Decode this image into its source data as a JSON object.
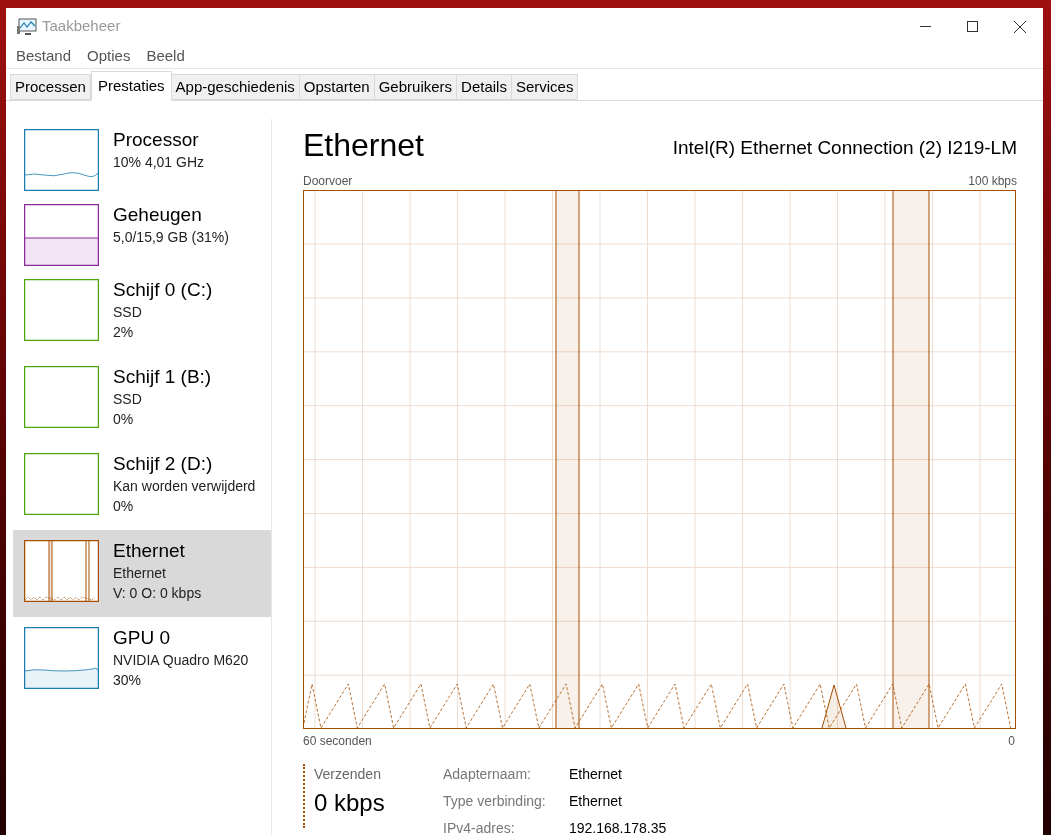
{
  "window": {
    "title": "Taakbeheer"
  },
  "menu": [
    "Bestand",
    "Opties",
    "Beeld"
  ],
  "tabs": [
    {
      "label": "Processen",
      "selected": false
    },
    {
      "label": "Prestaties",
      "selected": true
    },
    {
      "label": "App-geschiedenis",
      "selected": false
    },
    {
      "label": "Opstarten",
      "selected": false
    },
    {
      "label": "Gebruikers",
      "selected": false
    },
    {
      "label": "Details",
      "selected": false
    },
    {
      "label": "Services",
      "selected": false
    }
  ],
  "sidebar": {
    "items": [
      {
        "kind": "cpu",
        "name": "Processor",
        "lines": [
          "10% 4,01 GHz"
        ],
        "color": "#1a7dae",
        "selected": false
      },
      {
        "kind": "memory",
        "name": "Geheugen",
        "lines": [
          "5,0/15,9 GB (31%)"
        ],
        "color": "#8b2a9b",
        "selected": false
      },
      {
        "kind": "disk",
        "name": "Schijf 0 (C:)",
        "lines": [
          "SSD",
          "2%"
        ],
        "color": "#4da60c",
        "selected": false
      },
      {
        "kind": "disk",
        "name": "Schijf 1 (B:)",
        "lines": [
          "SSD",
          "0%"
        ],
        "color": "#4da60c",
        "selected": false
      },
      {
        "kind": "disk",
        "name": "Schijf 2 (D:)",
        "lines": [
          "Kan worden verwijderd",
          "0%"
        ],
        "color": "#4da60c",
        "selected": false
      },
      {
        "kind": "network",
        "name": "Ethernet",
        "lines": [
          "Ethernet",
          "V: 0 O: 0 kbps"
        ],
        "color": "#a74f01",
        "selected": true
      },
      {
        "kind": "gpu",
        "name": "GPU 0",
        "lines": [
          "NVIDIA Quadro M620",
          "30%"
        ],
        "color": "#1a7dae",
        "selected": false
      }
    ]
  },
  "main": {
    "title": "Ethernet",
    "device": "Intel(R) Ethernet Connection (2) I219-LM",
    "graph": {
      "label": "Doorvoer",
      "max": "100 kbps",
      "x_start": "60 seconden",
      "x_end": "0"
    },
    "send": {
      "label": "Verzenden",
      "value": "0 kbps"
    },
    "details": [
      {
        "label": "Adapternaam:",
        "value": "Ethernet"
      },
      {
        "label": "Type verbinding:",
        "value": "Ethernet"
      },
      {
        "label": "IPv4-adres:",
        "value": "192.168.178.35"
      }
    ]
  }
}
